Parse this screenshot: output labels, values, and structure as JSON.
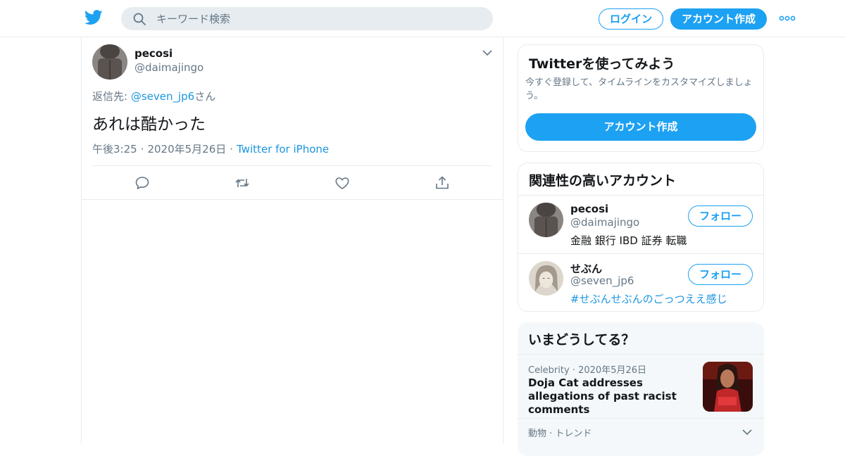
{
  "header": {
    "logo_icon": "twitter-bird-icon",
    "search_placeholder": "キーワード検索",
    "login_label": "ログイン",
    "signup_label": "アカウント作成",
    "more_icon": "more-dots-icon",
    "brand_color": "#1da1f2"
  },
  "tweet": {
    "name": "pecosi",
    "handle": "@daimajingo",
    "reply_prefix": "返信先: ",
    "reply_mention": "@seven_jp6",
    "reply_suffix": "さん",
    "text": "あれは酷かった",
    "time": "午後3:25",
    "date": "2020年5月26日",
    "source": "Twitter for iPhone",
    "separator": "·",
    "actions": [
      "reply-icon",
      "retweet-icon",
      "like-icon",
      "share-icon"
    ]
  },
  "signup_card": {
    "title": "Twitterを使ってみよう",
    "description": "今すぐ登録して、タイムラインをカスタマイズしましょう。",
    "button": "アカウント作成"
  },
  "related": {
    "title": "関連性の高いアカウント",
    "accounts": [
      {
        "name": "pecosi",
        "handle": "@daimajingo",
        "bio": "金融 銀行 IBD 証券 転職",
        "follow": "フォロー"
      },
      {
        "name": "せぶん",
        "handle": "@seven_jp6",
        "bio": "#せぶんせぶんのごっつええ感じ",
        "follow": "フォロー"
      }
    ]
  },
  "trends": {
    "title": "いまどうしてる？",
    "items": [
      {
        "category": "Celebrity",
        "separator": "·",
        "date": "2020年5月26日",
        "headline": "Doja Cat addresses allegations of past racist comments"
      }
    ],
    "next_category": "動物 · トレンド"
  }
}
